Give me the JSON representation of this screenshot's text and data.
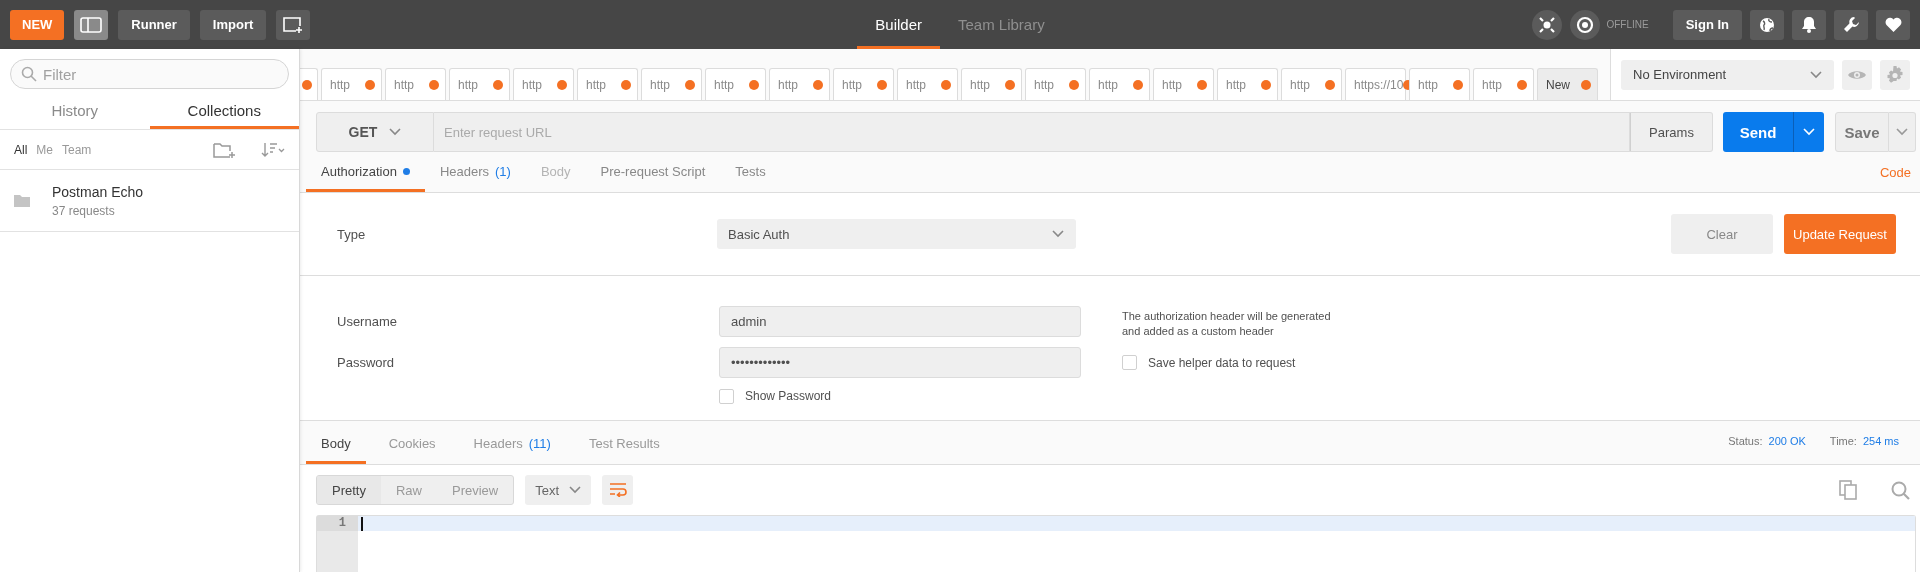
{
  "header": {
    "new_button": "NEW",
    "buttons": [
      "Runner",
      "Import"
    ],
    "nav_tabs": [
      {
        "label": "Builder",
        "selected": true
      },
      {
        "label": "Team Library",
        "selected": false
      }
    ],
    "sync_status": "OFFLINE",
    "sign_in": "Sign In"
  },
  "sidebar": {
    "filter_placeholder": "Filter",
    "tabs": [
      {
        "label": "History",
        "selected": false
      },
      {
        "label": "Collections",
        "selected": true
      }
    ],
    "owner_filters": [
      {
        "label": "All",
        "selected": true
      },
      {
        "label": "Me",
        "selected": false
      },
      {
        "label": "Team",
        "selected": false
      }
    ],
    "collections": [
      {
        "name": "Postman Echo",
        "count": "37 requests"
      }
    ]
  },
  "request_tabs": [
    {
      "unsaved": true,
      "selected": false
    },
    {
      "label": "http",
      "unsaved": true,
      "selected": false
    },
    {
      "label": "http",
      "unsaved": true,
      "selected": false
    },
    {
      "label": "http",
      "unsaved": true,
      "selected": false
    },
    {
      "label": "http",
      "unsaved": true,
      "selected": false
    },
    {
      "label": "http",
      "unsaved": true,
      "selected": false
    },
    {
      "label": "http",
      "unsaved": true,
      "selected": false
    },
    {
      "label": "http",
      "unsaved": true,
      "selected": false
    },
    {
      "label": "http",
      "unsaved": true,
      "selected": false
    },
    {
      "label": "http",
      "unsaved": true,
      "selected": false
    },
    {
      "label": "http",
      "unsaved": true,
      "selected": false
    },
    {
      "label": "http",
      "unsaved": true,
      "selected": false
    },
    {
      "label": "http",
      "unsaved": true,
      "selected": false
    },
    {
      "label": "http",
      "unsaved": true,
      "selected": false
    },
    {
      "label": "http",
      "unsaved": true,
      "selected": false
    },
    {
      "label": "http",
      "unsaved": true,
      "selected": false
    },
    {
      "label": "http",
      "unsaved": true,
      "selected": false
    },
    {
      "label": "https://10",
      "unsaved": true,
      "selected": false
    },
    {
      "label": "http",
      "unsaved": true,
      "selected": false
    },
    {
      "label": "http",
      "unsaved": true,
      "selected": false
    },
    {
      "label": "New",
      "unsaved": true,
      "selected": true
    }
  ],
  "environment": {
    "value": "No Environment"
  },
  "request": {
    "method": "GET",
    "url_placeholder": "Enter request URL",
    "params": "Params",
    "send": "Send",
    "save": "Save"
  },
  "request_sections": [
    {
      "label": "Authorization",
      "selected": true,
      "disabled": false,
      "indicator": true
    },
    {
      "label": "Headers",
      "count": "(1)",
      "selected": false,
      "disabled": false,
      "indicator": false
    },
    {
      "label": "Body",
      "selected": false,
      "disabled": true,
      "indicator": false
    },
    {
      "label": "Pre-request Script",
      "selected": false,
      "disabled": false,
      "indicator": false
    },
    {
      "label": "Tests",
      "selected": false,
      "disabled": false,
      "indicator": false
    }
  ],
  "code_link": "Code",
  "auth": {
    "type_label": "Type",
    "type_value": "Basic Auth",
    "clear": "Clear",
    "update": "Update Request",
    "username_label": "Username",
    "username": "admin",
    "password_label": "Password",
    "password": "•••••••••••••",
    "show_password": {
      "label": "Show Password",
      "checked": false
    },
    "help": "The authorization header will be generated and added as a custom header",
    "save_helper": {
      "label": "Save helper data to request",
      "checked": false
    }
  },
  "response": {
    "tabs": [
      {
        "label": "Body",
        "selected": true
      },
      {
        "label": "Cookies",
        "selected": false
      },
      {
        "label": "Headers",
        "count": "(11)",
        "selected": false
      },
      {
        "label": "Test Results",
        "selected": false
      }
    ],
    "status_label": "Status:",
    "status": "200 OK",
    "time_label": "Time:",
    "time": "254 ms",
    "view_modes": [
      {
        "label": "Pretty",
        "selected": true
      },
      {
        "label": "Raw",
        "selected": false
      },
      {
        "label": "Preview",
        "selected": false
      }
    ],
    "format": "Text",
    "line_numbers": [
      "1"
    ]
  }
}
